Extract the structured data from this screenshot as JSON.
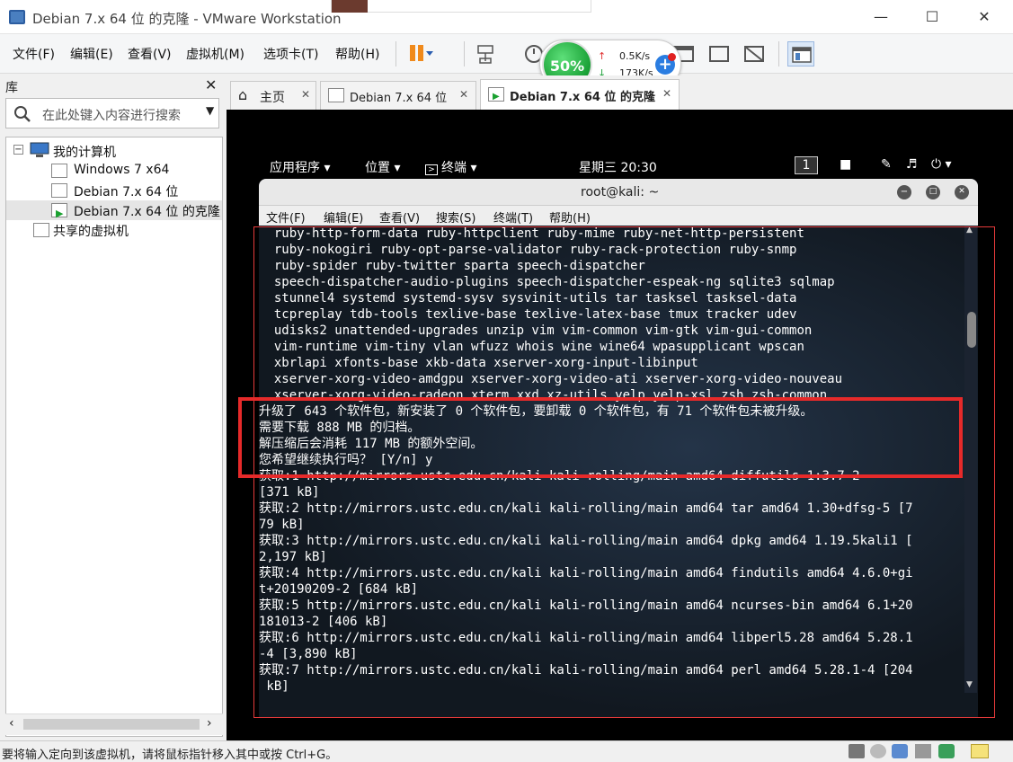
{
  "window": {
    "title": "Debian 7.x 64 位 的克隆 - VMware Workstation",
    "controls": [
      "minimize-icon",
      "maximize-icon",
      "close-icon"
    ]
  },
  "menu": [
    "文件(F)",
    "编辑(E)",
    "查看(V)",
    "虚拟机(M)",
    "选项卡(T)",
    "帮助(H)"
  ],
  "perf": {
    "percent": "50%",
    "upload": "0.5K/s",
    "download": "173K/s"
  },
  "library": {
    "title": "库",
    "search_placeholder": "在此处键入内容进行搜索",
    "tree": [
      {
        "label": "我的计算机",
        "level": 0,
        "icon": "computer-icon"
      },
      {
        "label": "Windows 7 x64",
        "level": 1,
        "icon": "vm-icon"
      },
      {
        "label": "Debian 7.x 64 位",
        "level": 1,
        "icon": "vm-icon"
      },
      {
        "label": "Debian 7.x 64 位 的克隆",
        "level": 1,
        "icon": "vm-running-icon",
        "selected": true
      },
      {
        "label": "共享的虚拟机",
        "level": 0,
        "icon": "shared-vm-icon"
      }
    ]
  },
  "tabs": [
    {
      "label": "主页",
      "icon": "home-icon"
    },
    {
      "label": "Debian 7.x 64 位",
      "icon": "vm-icon"
    },
    {
      "label": "Debian 7.x 64 位 的克隆",
      "icon": "vm-running-icon",
      "active": true
    }
  ],
  "gnome": {
    "apps": "应用程序",
    "places": "位置",
    "terminal": "终端",
    "clock": "星期三 20:30",
    "workspace": "1"
  },
  "terminal": {
    "title": "root@kali: ~",
    "menu": [
      "文件(F)",
      "编辑(E)",
      "查看(V)",
      "搜索(S)",
      "终端(T)",
      "帮助(H)"
    ],
    "lines": [
      "  ruby-http-form-data ruby-httpclient ruby-mime ruby-net-http-persistent",
      "  ruby-nokogiri ruby-opt-parse-validator ruby-rack-protection ruby-snmp",
      "  ruby-spider ruby-twitter sparta speech-dispatcher",
      "  speech-dispatcher-audio-plugins speech-dispatcher-espeak-ng sqlite3 sqlmap",
      "  stunnel4 systemd systemd-sysv sysvinit-utils tar tasksel tasksel-data",
      "  tcpreplay tdb-tools texlive-base texlive-latex-base tmux tracker udev",
      "  udisks2 unattended-upgrades unzip vim vim-common vim-gtk vim-gui-common",
      "  vim-runtime vim-tiny vlan wfuzz whois wine wine64 wpasupplicant wpscan",
      "  xbrlapi xfonts-base xkb-data xserver-xorg-input-libinput",
      "  xserver-xorg-video-amdgpu xserver-xorg-video-ati xserver-xorg-video-nouveau",
      "  xserver-xorg-video-radeon xterm xxd xz-utils yelp yelp-xsl zsh zsh-common",
      "升级了 643 个软件包，新安装了 0 个软件包，要卸载 0 个软件包，有 71 个软件包未被升级。",
      "需要下载 888 MB 的归档。",
      "解压缩后会消耗 117 MB 的额外空间。",
      "您希望继续执行吗？ [Y/n] y",
      "获取:1 http://mirrors.ustc.edu.cn/kali kali-rolling/main amd64 diffutils 1:3.7-2",
      "[371 kB]",
      "获取:2 http://mirrors.ustc.edu.cn/kali kali-rolling/main amd64 tar amd64 1.30+dfsg-5 [7",
      "79 kB]",
      "获取:3 http://mirrors.ustc.edu.cn/kali kali-rolling/main amd64 dpkg amd64 1.19.5kali1 [",
      "2,197 kB]",
      "获取:4 http://mirrors.ustc.edu.cn/kali kali-rolling/main amd64 findutils amd64 4.6.0+gi",
      "t+20190209-2 [684 kB]",
      "获取:5 http://mirrors.ustc.edu.cn/kali kali-rolling/main amd64 ncurses-bin amd64 6.1+20",
      "181013-2 [406 kB]",
      "获取:6 http://mirrors.ustc.edu.cn/kali kali-rolling/main amd64 libperl5.28 amd64 5.28.1",
      "-4 [3,890 kB]",
      "获取:7 http://mirrors.ustc.edu.cn/kali kali-rolling/main amd64 perl amd64 5.28.1-4 [204",
      " kB]"
    ]
  },
  "status": {
    "text": "要将输入定向到该虚拟机，请将鼠标指针移入其中或按 Ctrl+G。"
  },
  "colors": {
    "annotation": "#e62a2a",
    "perf_green": "#18a035",
    "terminal_bg": "#1b2330"
  }
}
